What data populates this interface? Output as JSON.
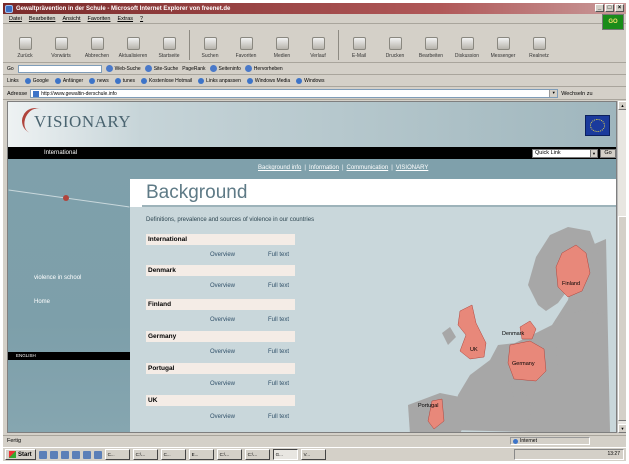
{
  "window": {
    "title": "Gewaltprävention in der Schule - Microsoft Internet Explorer von freenet.de",
    "buttons": [
      "_",
      "□",
      "×"
    ],
    "throbber_label": "GO"
  },
  "menu": [
    "Datei",
    "Bearbeiten",
    "Ansicht",
    "Favoriten",
    "Extras",
    "?"
  ],
  "toolbar": [
    {
      "label": "Zurück",
      "icon": "back-arrow-icon"
    },
    {
      "label": "Vorwärts",
      "icon": "forward-arrow-icon"
    },
    {
      "label": "Abbrechen",
      "icon": "stop-icon"
    },
    {
      "label": "Aktualisieren",
      "icon": "refresh-icon"
    },
    {
      "label": "Startseite",
      "icon": "home-icon"
    },
    {
      "label": "Suchen",
      "icon": "search-icon"
    },
    {
      "label": "Favoriten",
      "icon": "favorites-icon"
    },
    {
      "label": "Medien",
      "icon": "media-icon"
    },
    {
      "label": "Verlauf",
      "icon": "history-icon"
    },
    {
      "label": "E-Mail",
      "icon": "mail-icon"
    },
    {
      "label": "Drucken",
      "icon": "print-icon"
    },
    {
      "label": "Bearbeiten",
      "icon": "edit-icon"
    },
    {
      "label": "Diskussion",
      "icon": "discuss-icon"
    },
    {
      "label": "Messenger",
      "icon": "messenger-icon"
    },
    {
      "label": "Realnetz",
      "icon": "real-icon"
    }
  ],
  "googlebar": {
    "label": "Go",
    "buttons": [
      "Web-Suche",
      "Site-Suche",
      "PageRank",
      "Seiteninfo",
      "Hervorheben"
    ]
  },
  "linksbar": {
    "label": "Links",
    "items": [
      "Google",
      "Anfänger",
      "news",
      "tunes",
      "Kostenlose Hotmail",
      "Links anpassen",
      "Windows Media",
      "Windows"
    ]
  },
  "address": {
    "label": "Adresse",
    "url": "http://www.gewaltin-derschule.info",
    "go": "Wechseln zu"
  },
  "site": {
    "logo": "VISIONARY",
    "blackbar_label": "International",
    "quicklink": "Quick Link",
    "go": "Go",
    "left_nav": [
      "violence in school",
      "Home"
    ],
    "left_blackbar": "ENGLISH",
    "nav_links": [
      "Background info",
      "Information",
      "Communication",
      "VISIONARY"
    ],
    "nav_separator": "|",
    "page_title": "Background",
    "intro": "Definitions, prevalence and sources of violence in our countries",
    "overview_label": "Overview",
    "fulltext_label": "Full text",
    "countries": [
      "International",
      "Denmark",
      "Finland",
      "Germany",
      "Portugal",
      "UK"
    ],
    "map_labels": [
      "Finland",
      "Denmark",
      "UK",
      "Germany",
      "Portugal"
    ]
  },
  "status": {
    "left": "Fertig",
    "zone": "Internet"
  },
  "taskbar": {
    "start": "Start",
    "tasks": [
      "C...",
      "C:\\...",
      "C...",
      "E...",
      "C:\\...",
      "C:\\...",
      "G...",
      "V..."
    ],
    "clock": "13:27"
  },
  "colors": {
    "title_bar": "#7a2a2a",
    "site_teal": "#7fa0ab",
    "main_bg": "#c9d7db",
    "map_land": "#a7a7a7",
    "map_highlight": "#e8887a",
    "logo_red": "#b0443c"
  }
}
